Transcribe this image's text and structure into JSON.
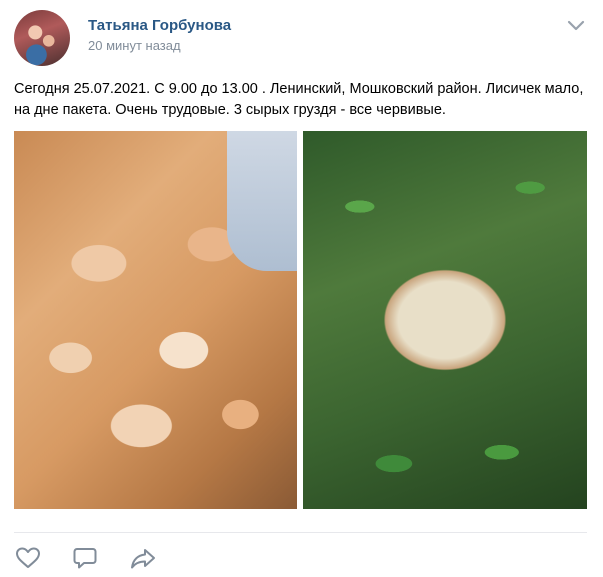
{
  "post": {
    "author": "Татьяна Горбунова",
    "time": "20 минут назад",
    "text": "Сегодня 25.07.2021. С 9.00 до 13.00 . Ленинский, Мошковский район. Лисичек мало, на дне пакета. Очень трудовые. 3 сырых груздя - все червивые.",
    "menu_icon": "chevron-down-icon"
  },
  "photos": [
    {
      "name": "photo-chanterelles",
      "description_icon": "image"
    },
    {
      "name": "photo-milk-cap",
      "description_icon": "image"
    }
  ],
  "actions": {
    "like_icon": "heart-icon",
    "comment_icon": "comment-icon",
    "share_icon": "share-icon"
  },
  "colors": {
    "author": "#2a5885",
    "meta": "#818c99",
    "icon": "#818c99",
    "divider": "#e7e8ec"
  }
}
